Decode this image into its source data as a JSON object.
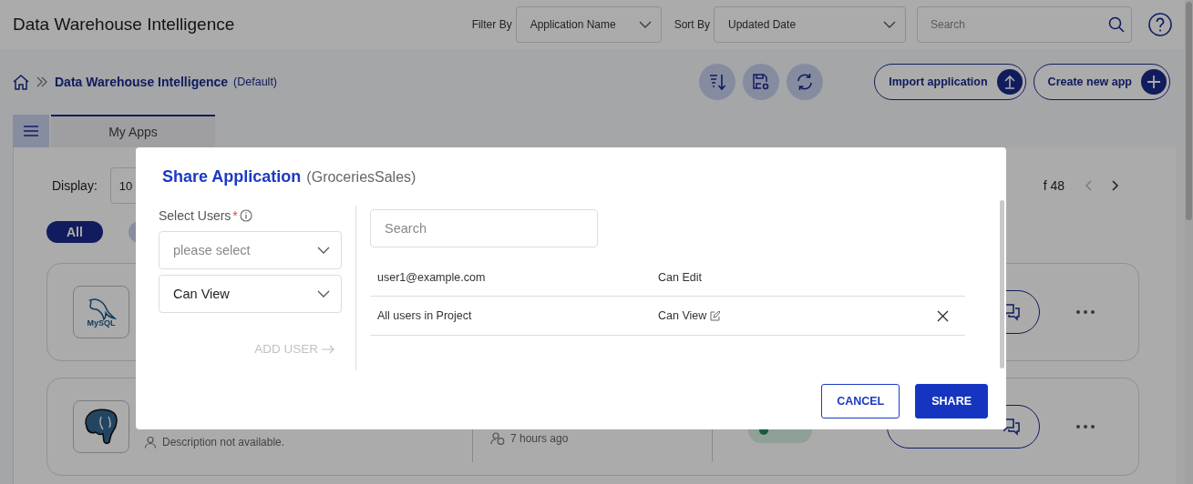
{
  "header": {
    "title": "Data Warehouse Intelligence",
    "filter_label": "Filter By",
    "filter_value": "Application Name",
    "sort_label": "Sort By",
    "sort_value": "Updated Date",
    "search": {
      "placeholder": "Search"
    }
  },
  "breadcrumb": {
    "project": "Data Warehouse Intelligence",
    "note": "(Default)"
  },
  "actions": [
    {
      "label": "Import application",
      "kind": "import"
    },
    {
      "label": "Create new app",
      "kind": "create"
    }
  ],
  "tabs": [
    {
      "label": "My Apps",
      "selected": true
    }
  ],
  "display": {
    "label": "Display:",
    "value": "10"
  },
  "pagination": {
    "text": "f 48"
  },
  "chips": [
    {
      "label": "All",
      "selected": true
    }
  ],
  "apps": [
    {
      "kind": "mysql",
      "logo_text": "MySQL"
    },
    {
      "kind": "postgres",
      "description": "Description not available.",
      "updated": "7 hours ago"
    }
  ],
  "modal": {
    "title": "Share Application",
    "subtitle": "(GroceriesSales)",
    "select_label": "Select Users",
    "required_mark": "*",
    "user_select": {
      "placeholder": "please select"
    },
    "permission_select": {
      "value": "Can View"
    },
    "add_user": {
      "label": "ADD USER",
      "disabled": true
    },
    "search": {
      "placeholder": "Search"
    },
    "shares": [
      {
        "user": "user1@example.com",
        "permission": "Can Edit",
        "editable": false,
        "removable": false
      },
      {
        "user": "All users in Project",
        "permission": "Can View",
        "editable": true,
        "removable": true
      }
    ],
    "buttons": [
      {
        "label": "CANCEL",
        "kind": "secondary"
      },
      {
        "label": "SHARE",
        "kind": "primary"
      }
    ]
  }
}
